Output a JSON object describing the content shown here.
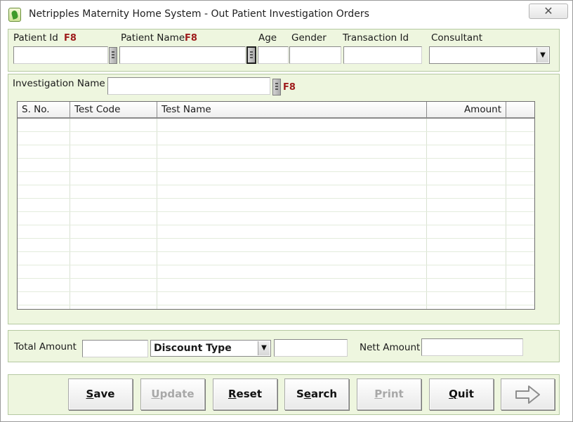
{
  "window": {
    "title": "Netripples Maternity Home System - Out Patient Investigation Orders",
    "close_symbol": "✕"
  },
  "header_fields": {
    "patient_id_label": "Patient Id",
    "patient_id_hotkey": "F8",
    "patient_id_value": "",
    "patient_name_label": "Patient Name",
    "patient_name_hotkey": "F8",
    "patient_name_value": "",
    "age_label": "Age",
    "age_value": "",
    "gender_label": "Gender",
    "gender_value": "",
    "transaction_id_label": "Transaction Id",
    "transaction_id_value": "",
    "consultant_label": "Consultant",
    "consultant_value": ""
  },
  "investigation": {
    "label": "Investigation Name",
    "hotkey": "F8",
    "value": ""
  },
  "grid": {
    "columns": [
      "S. No.",
      "Test Code",
      "Test Name",
      "Amount"
    ],
    "rows": []
  },
  "totals": {
    "total_amount_label": "Total Amount",
    "total_amount_value": "",
    "discount_type_value": "Discount Type",
    "discount_value": "",
    "nett_amount_label": "Nett Amount",
    "nett_amount_value": ""
  },
  "buttons": {
    "save": {
      "mnemonic": "S",
      "rest": "ave",
      "enabled": true
    },
    "update": {
      "mnemonic": "U",
      "rest": "pdate",
      "enabled": false
    },
    "reset": {
      "mnemonic": "R",
      "rest": "eset",
      "enabled": true
    },
    "search": {
      "before": "S",
      "mnemonic": "e",
      "rest": "arch",
      "enabled": true
    },
    "print": {
      "mnemonic": "P",
      "rest": "rint",
      "enabled": false
    },
    "quit": {
      "mnemonic": "Q",
      "rest": "uit",
      "enabled": true
    },
    "next_icon": "right-arrow-icon"
  },
  "colors": {
    "panel_bg": "#eef6df",
    "hotkey": "#9e1b1b",
    "disabled_text": "#a8a8a8"
  }
}
